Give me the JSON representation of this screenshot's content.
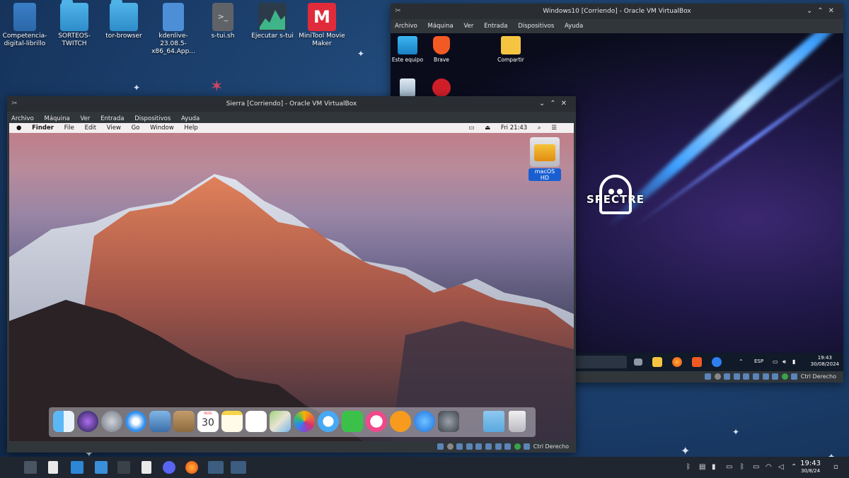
{
  "desktop": {
    "icons": [
      {
        "label": "Competencia-digital-librillo",
        "icon": "archive-icon"
      },
      {
        "label": "SORTEOS-TWITCH",
        "icon": "folder-icon"
      },
      {
        "label": "tor-browser",
        "icon": "folder-icon"
      },
      {
        "label": "kdenlive-23.08.5-x86_64.App...",
        "icon": "appimage-icon"
      },
      {
        "label": "s-tui.sh",
        "icon": "terminal-script-icon"
      },
      {
        "label": "Ejecutar s-tui",
        "icon": "graph-icon"
      },
      {
        "label": "MiniTool Movie Maker",
        "icon": "minitool-icon"
      }
    ]
  },
  "win10_window": {
    "title": "Windows10 [Corriendo] - Oracle VM VirtualBox",
    "menu": [
      "Archivo",
      "Máquina",
      "Ver",
      "Entrada",
      "Dispositivos",
      "Ayuda"
    ],
    "desktop_icons": [
      {
        "label": "Este equipo",
        "icon": "computer-icon"
      },
      {
        "label": "Brave",
        "icon": "brave-icon"
      },
      {
        "label": "Compartir",
        "icon": "folder-icon"
      },
      {
        "label": "",
        "icon": "recycle-bin-icon"
      },
      {
        "label": "",
        "icon": "app-e-icon"
      }
    ],
    "wallpaper_text": "SPECTRE",
    "taskbar": {
      "lang": "ESP",
      "time": "19:43",
      "date": "30/08/2024"
    },
    "status_text": "Ctrl Derecho"
  },
  "sierra_window": {
    "title": "Sierra [Corriendo] - Oracle VM VirtualBox",
    "menu": [
      "Archivo",
      "Máquina",
      "Ver",
      "Entrada",
      "Dispositivos",
      "Ayuda"
    ],
    "mac_menubar": {
      "apple": "",
      "items": [
        "Finder",
        "File",
        "Edit",
        "View",
        "Go",
        "Window",
        "Help"
      ],
      "clock": "Fri 21:43"
    },
    "hd_label": "macOS HD",
    "calendar_day": "30",
    "calendar_month": "AUG",
    "status_text": "Ctrl Derecho"
  },
  "host_taskbar": {
    "time": "19:43",
    "date": "30/8/24"
  },
  "colors": {
    "desktop_bg": "#1f4675",
    "vbox_bar": "#31363b",
    "accent_blue": "#1a5fd1"
  }
}
